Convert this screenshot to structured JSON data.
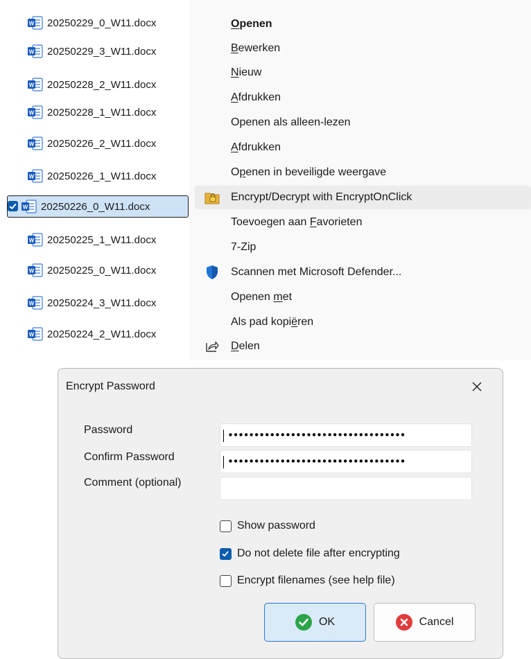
{
  "files": [
    {
      "name": "20250229_0_W11.docx",
      "selected": false,
      "icon": "word-doc-icon"
    },
    {
      "name": "20250229_3_W11.docx",
      "selected": false,
      "icon": "word-doc-icon"
    },
    {
      "name": "20250228_2_W11.docx",
      "selected": false,
      "icon": "word-doc-icon"
    },
    {
      "name": "20250228_1_W11.docx",
      "selected": false,
      "icon": "word-doc-icon"
    },
    {
      "name": "20250226_2_W11.docx",
      "selected": false,
      "icon": "word-doc-icon"
    },
    {
      "name": "20250226_1_W11.docx",
      "selected": false,
      "icon": "word-doc-icon"
    },
    {
      "name": "20250226_0_W11.docx",
      "selected": true,
      "icon": "word-doc-icon"
    },
    {
      "name": "20250225_1_W11.docx",
      "selected": false,
      "icon": "word-doc-icon"
    },
    {
      "name": "20250225_0_W11.docx",
      "selected": false,
      "icon": "word-doc-icon"
    },
    {
      "name": "20250224_3_W11.docx",
      "selected": false,
      "icon": "word-doc-icon"
    },
    {
      "name": "20250224_2_W11.docx",
      "selected": false,
      "icon": "word-doc-icon"
    }
  ],
  "context_menu": {
    "items": [
      {
        "pre": "",
        "key": "O",
        "post": "penen",
        "bold": true,
        "icon": ""
      },
      {
        "pre": "",
        "key": "B",
        "post": "ewerken",
        "bold": false,
        "icon": ""
      },
      {
        "pre": "",
        "key": "N",
        "post": "ieuw",
        "bold": false,
        "icon": ""
      },
      {
        "pre": "",
        "key": "A",
        "post": "fdrukken",
        "bold": false,
        "icon": ""
      },
      {
        "pre": "Openen als alleen-lezen",
        "key": "",
        "post": "",
        "bold": false,
        "icon": ""
      },
      {
        "pre": "",
        "key": "A",
        "post": "fdrukken",
        "bold": false,
        "icon": ""
      },
      {
        "pre": "O",
        "key": "p",
        "post": "enen in beveiligde weergave",
        "bold": false,
        "icon": ""
      },
      {
        "pre": "Encrypt/Decrypt with EncryptOnClick",
        "key": "",
        "post": "",
        "bold": false,
        "icon": "encryptonclick-lock-icon",
        "hover": true
      },
      {
        "pre": "Toevoegen aan ",
        "key": "F",
        "post": "avorieten",
        "bold": false,
        "icon": ""
      },
      {
        "pre": "7-Zip",
        "key": "",
        "post": "",
        "bold": false,
        "icon": ""
      },
      {
        "pre": "Scannen met Microsoft Defender...",
        "key": "",
        "post": "",
        "bold": false,
        "icon": "defender-shield-icon"
      },
      {
        "pre": "Openen ",
        "key": "m",
        "post": "et",
        "bold": false,
        "icon": ""
      },
      {
        "pre": "Als pad kopi",
        "key": "ë",
        "post": "ren",
        "bold": false,
        "icon": ""
      },
      {
        "pre": "",
        "key": "D",
        "post": "elen",
        "bold": false,
        "icon": "share-icon"
      }
    ]
  },
  "dialog": {
    "title": "Encrypt Password",
    "password_label": "Password",
    "password_value": "••••••••••••••••••••••••••••••••••",
    "confirm_label": "Confirm Password",
    "confirm_value": "••••••••••••••••••••••••••••••••••",
    "comment_label": "Comment (optional)",
    "comment_value": "",
    "checkboxes": [
      {
        "label": "Show password",
        "checked": false
      },
      {
        "label": "Do not delete file after encrypting",
        "checked": true
      },
      {
        "label": "Encrypt filenames (see help file)",
        "checked": false
      }
    ],
    "ok_label": "OK",
    "cancel_label": "Cancel"
  },
  "colors": {
    "selection_bg": "#cfe3f7",
    "accent": "#0b5cad",
    "ok_green": "#2ba44a",
    "cancel_red": "#e03c3c",
    "defender_blue": "#1f74d4"
  }
}
